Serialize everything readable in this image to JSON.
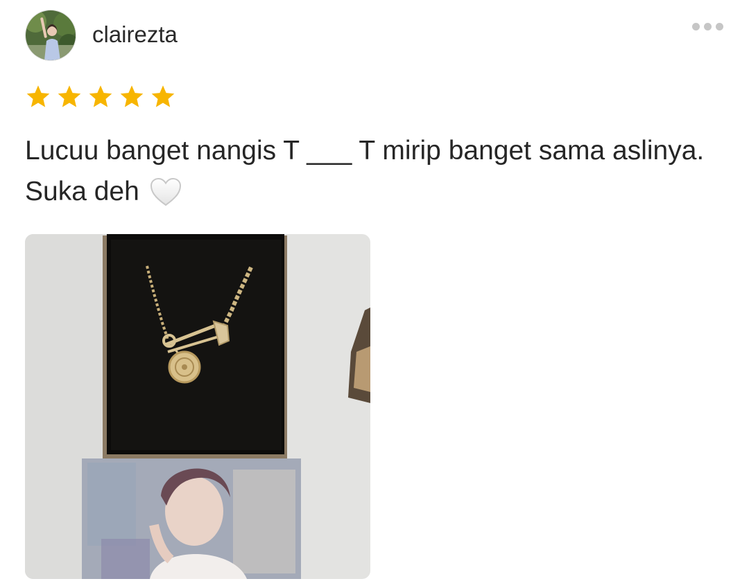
{
  "review": {
    "username": "clairezta",
    "rating": 5,
    "rating_max": 5,
    "text": "Lucuu banget nangis T ___ T mirip banget sama aslinya. Suka deh",
    "emoji_icon": "white-heart-icon",
    "star_color": "#f7b500",
    "has_photo": true
  }
}
